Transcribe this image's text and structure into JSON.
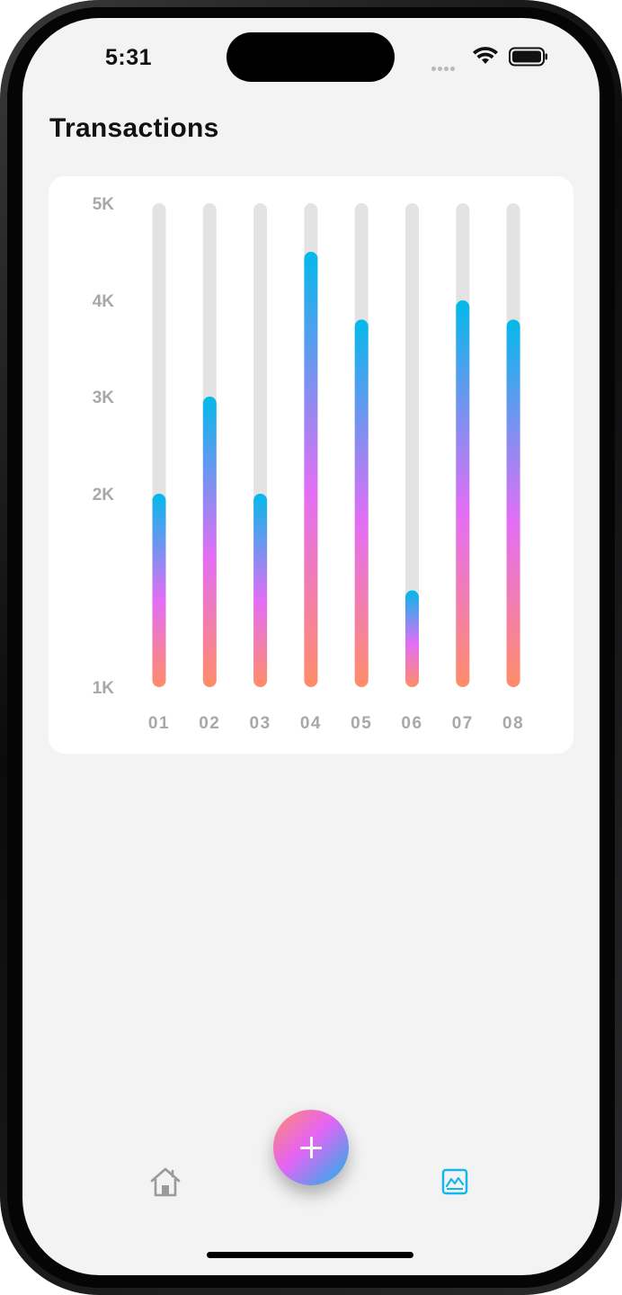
{
  "status_bar": {
    "time": "5:31"
  },
  "header": {
    "title": "Transactions"
  },
  "colors": {
    "accent_top": "#03b9ea",
    "accent_mid": "#e36ef5",
    "accent_bottom": "#ff8d68",
    "track": "#e3e3e3",
    "tick_text": "#a8a8a8",
    "active_tab": "#12b8ea",
    "inactive_tab": "#9a9a9a"
  },
  "chart_data": {
    "type": "bar",
    "categories": [
      "01",
      "02",
      "03",
      "04",
      "05",
      "06",
      "07",
      "08"
    ],
    "values": [
      2000,
      3000,
      2000,
      4500,
      3800,
      1500,
      4000,
      3800
    ],
    "y_tick_labels": [
      "5K",
      "4K",
      "3K",
      "2K",
      "1K"
    ],
    "ylim": [
      1000,
      5000
    ],
    "grid": false
  },
  "bottom_nav": {
    "items": [
      {
        "name": "home",
        "icon": "home-icon",
        "active": false
      },
      {
        "name": "add",
        "icon": "plus-icon"
      },
      {
        "name": "chart",
        "icon": "chart-icon",
        "active": true
      }
    ]
  }
}
